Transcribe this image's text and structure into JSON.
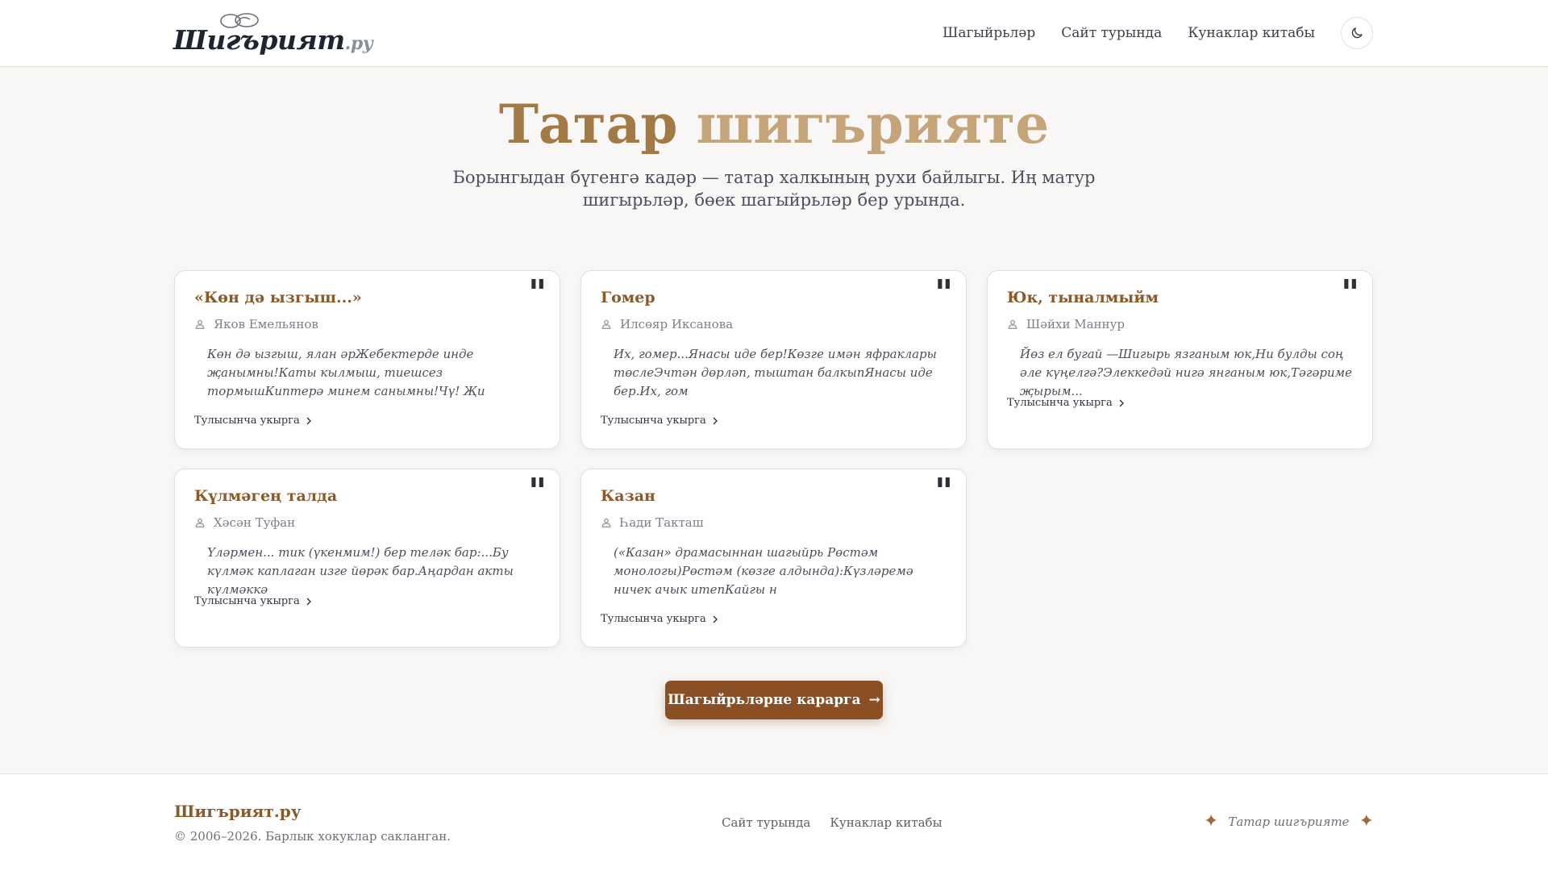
{
  "header": {
    "logo_text": "Шигърият",
    "logo_suffix": ".ру",
    "nav": [
      "Шагыйрьләр",
      "Сайт турында",
      "Кунаклар китабы"
    ],
    "theme_icon": "moon-icon"
  },
  "hero": {
    "title_part1": "Татар",
    "title_part2": "шигърияте",
    "subtitle": "Борынгыдан бүгенгә кадәр — татар халкының рухи байлыгы. Иң матур шигырьләр, бөек шагыйрьләр бер урында."
  },
  "cards": [
    {
      "title": "«Көн дә ызгыш...»",
      "author": "Яков Емельянов",
      "excerpt": "Көн дә ызгыш, ялан әрЖебектерде инде җанымны!Каты кылмыш, тиешсез тормышКиптерә минем санымны!Чү! Җи",
      "link": "Тулысынча укырга"
    },
    {
      "title": "Гомер",
      "author": "Илсөяр Иксанова",
      "excerpt": "Их, гомер...Янасы иде бер!Көзге имән яфраклары төслеЭчтән дөрләп, тыштан балкыпЯнасы иде бер.Их, гом",
      "link": "Тулысынча укырга"
    },
    {
      "title": "Юк, тыналмыйм",
      "author": "Шәйхи Маннур",
      "excerpt": "Йөз ел бугай —Шигырь язганым юк,Ни булды соң әле күңелгә?Элеккедәй нигә янганым юк,Тәгәриме җырым...",
      "link": "Тулысынча укырга"
    },
    {
      "title": "Күлмәгең талда",
      "author": "Хәсән Туфан",
      "excerpt": "Үләрмен... тик (үкенмим!) бер теләк бар:...Бу күлмәк каплаган изге йөрәк бар.Аңардан акты күлмәккә",
      "link": "Тулысынча укырга"
    },
    {
      "title": "Казан",
      "author": "Һади Такташ",
      "excerpt": "(«Казан» драмасыннан шагыйрь Рөстәм монологы)Рөстәм (көзге алдында):Күзләремә ничек ачык итепКайгы н",
      "link": "Тулысынча укырга"
    }
  ],
  "cta": {
    "label": "Шагыйрьләрне карарга",
    "arrow": "→"
  },
  "footer": {
    "brand": "Шигърият.ру",
    "copyright": "© 2006–2026. Барлык хокуклар сакланган.",
    "links": [
      "Сайт турында",
      "Кунаклар китабы"
    ],
    "tagline": "Татар шигърияте",
    "star": "✦"
  },
  "colors": {
    "accent": "#8b5a2b",
    "cta_bg": "#8b4f26",
    "title_dark": "#a37a45",
    "title_light": "#c4a478",
    "background": "#f8f7f6"
  }
}
